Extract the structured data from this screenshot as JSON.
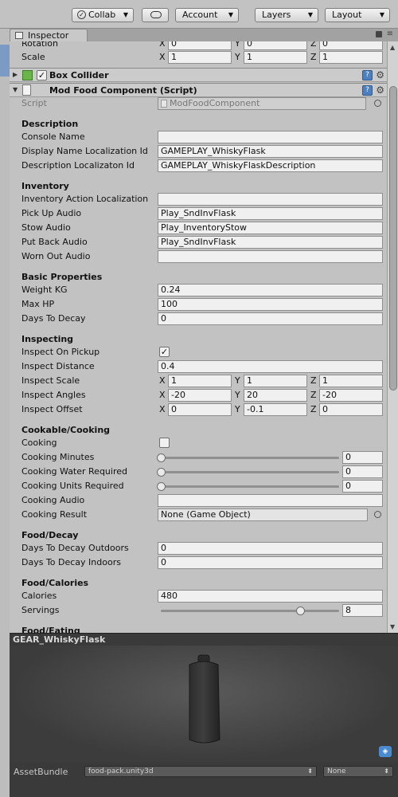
{
  "toolbar": {
    "collab": "Collab",
    "account": "Account",
    "layers": "Layers",
    "layout": "Layout"
  },
  "window": {
    "tab": "Inspector"
  },
  "transform": {
    "rotation_label": "Rotation",
    "rotation": {
      "x": "0",
      "y": "0",
      "z": "0"
    },
    "scale_label": "Scale",
    "scale": {
      "x": "1",
      "y": "1",
      "z": "1"
    }
  },
  "box_collider": {
    "title": "Box Collider",
    "enabled": true
  },
  "component": {
    "title": "Mod Food Component (Script)",
    "script_label": "Script",
    "script_value": "ModFoodComponent"
  },
  "description": {
    "header": "Description",
    "console_name_label": "Console Name",
    "console_name": "",
    "display_name_label": "Display Name Localization Id",
    "display_name": "GAMEPLAY_WhiskyFlask",
    "desc_label": "Description Localizaton Id",
    "desc": "GAMEPLAY_WhiskyFlaskDescription"
  },
  "inventory": {
    "header": "Inventory",
    "action_label": "Inventory Action Localization",
    "action": "",
    "pickup_label": "Pick Up Audio",
    "pickup": "Play_SndInvFlask",
    "stow_label": "Stow Audio",
    "stow": "Play_InventoryStow",
    "putback_label": "Put Back Audio",
    "putback": "Play_SndInvFlask",
    "wornout_label": "Worn Out Audio",
    "wornout": ""
  },
  "basic": {
    "header": "Basic Properties",
    "weight_label": "Weight KG",
    "weight": "0.24",
    "maxhp_label": "Max HP",
    "maxhp": "100",
    "decay_label": "Days To Decay",
    "decay": "0"
  },
  "inspecting": {
    "header": "Inspecting",
    "onpickup_label": "Inspect On Pickup",
    "onpickup": true,
    "distance_label": "Inspect Distance",
    "distance": "0.4",
    "scale_label": "Inspect Scale",
    "scale": {
      "x": "1",
      "y": "1",
      "z": "1"
    },
    "angles_label": "Inspect Angles",
    "angles": {
      "x": "-20",
      "y": "20",
      "z": "-20"
    },
    "offset_label": "Inspect Offset",
    "offset": {
      "x": "0",
      "y": "-0.1",
      "z": "0"
    }
  },
  "cooking": {
    "header": "Cookable/Cooking",
    "cooking_label": "Cooking",
    "cooking": false,
    "minutes_label": "Cooking Minutes",
    "minutes": "0",
    "water_label": "Cooking Water Required",
    "water": "0",
    "units_label": "Cooking Units Required",
    "units": "0",
    "audio_label": "Cooking Audio",
    "audio": "",
    "result_label": "Cooking Result",
    "result": "None (Game Object)"
  },
  "decay": {
    "header": "Food/Decay",
    "outdoors_label": "Days To Decay Outdoors",
    "outdoors": "0",
    "indoors_label": "Days To Decay Indoors",
    "indoors": "0"
  },
  "calories": {
    "header": "Food/Calories",
    "calories_label": "Calories",
    "calories": "480",
    "servings_label": "Servings",
    "servings": "8",
    "servings_slider": 0.78
  },
  "eating": {
    "header": "Food/Eating"
  },
  "axes": {
    "x": "X",
    "y": "Y",
    "z": "Z"
  },
  "preview": {
    "title": "GEAR_WhiskyFlask"
  },
  "assetbundle": {
    "label": "AssetBundle",
    "bundle": "food-pack.unity3d",
    "variant": "None"
  }
}
